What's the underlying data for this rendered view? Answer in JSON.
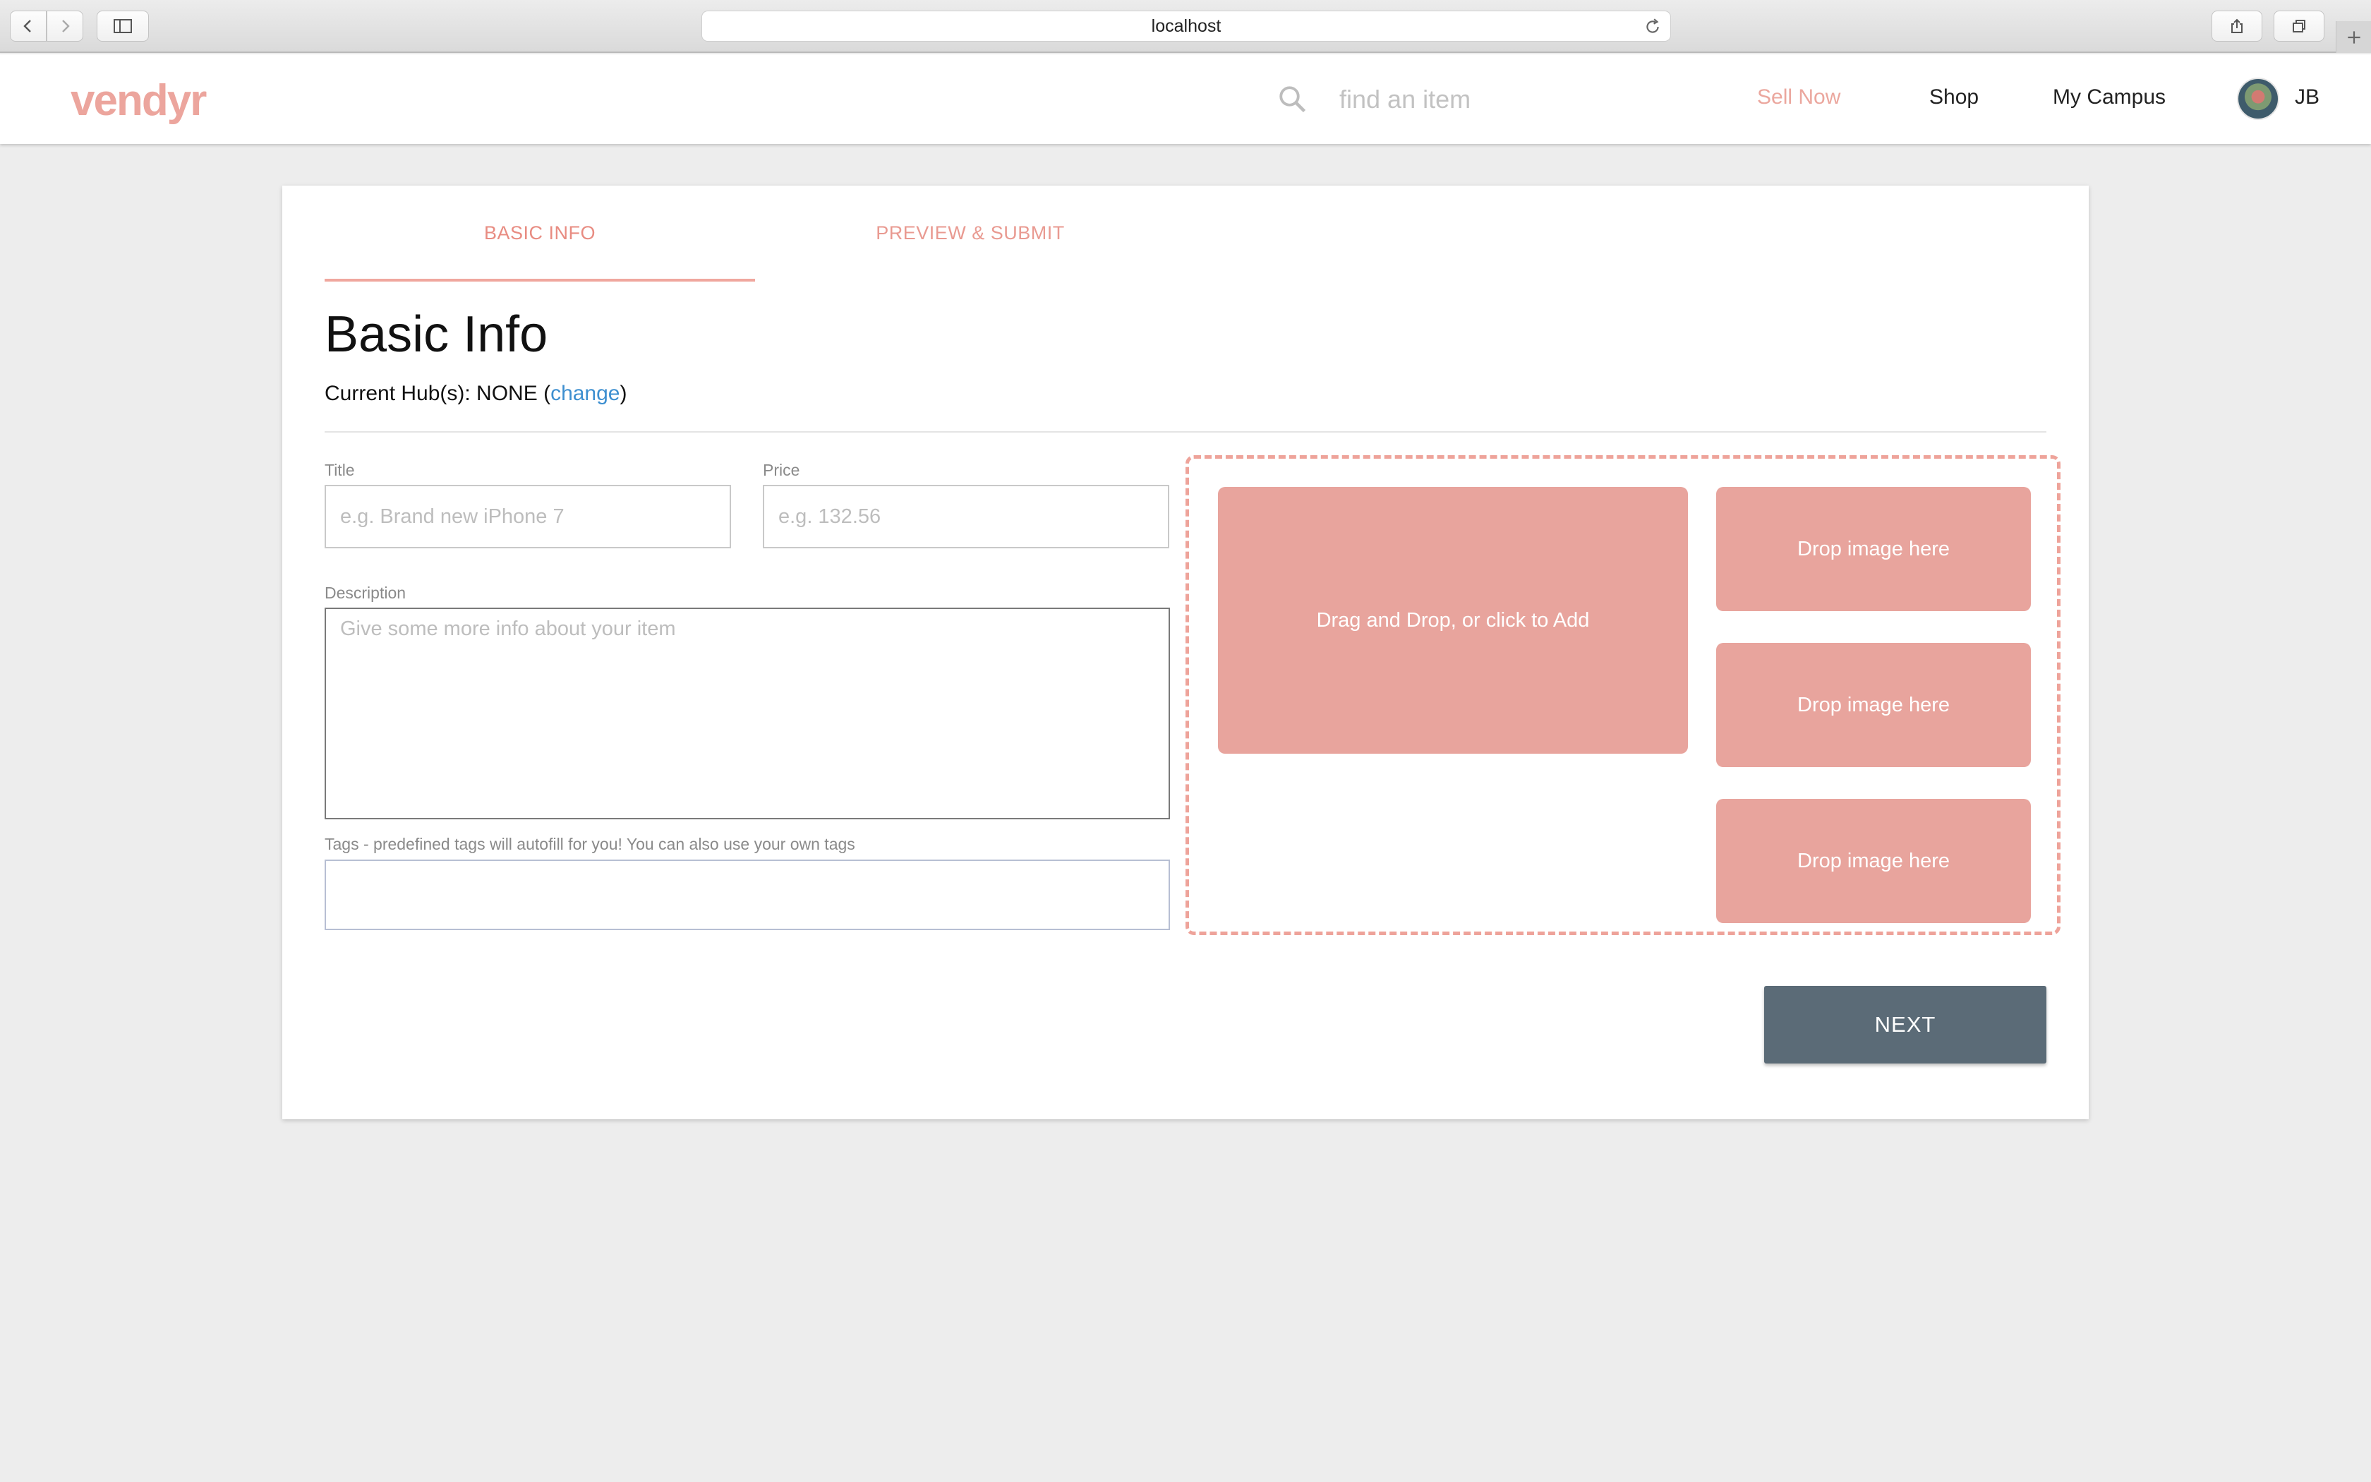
{
  "browser": {
    "url": "localhost"
  },
  "header": {
    "logo": "vendyr",
    "search_placeholder": "find an item",
    "nav": {
      "sell": "Sell Now",
      "shop": "Shop",
      "campus": "My Campus"
    },
    "user_initials": "JB"
  },
  "tabs": {
    "basic": "BASIC INFO",
    "preview": "PREVIEW & SUBMIT",
    "active": "BASIC INFO"
  },
  "form": {
    "heading": "Basic Info",
    "hub_prefix": "Current Hub(s): NONE (",
    "hub_change": "change",
    "hub_suffix": ")",
    "title_label": "Title",
    "title_placeholder": "e.g. Brand new iPhone 7",
    "title_value": "",
    "price_label": "Price",
    "price_placeholder": "e.g. 132.56",
    "price_value": "",
    "desc_label": "Description",
    "desc_placeholder": "Give some more info about your item",
    "desc_value": "",
    "tags_label": "Tags - predefined tags will autofill for you! You can also use your own tags",
    "tags_value": ""
  },
  "images": {
    "main": "Drag and Drop, or click to Add",
    "slots": [
      "Drop image here",
      "Drop image here",
      "Drop image here"
    ]
  },
  "actions": {
    "next": "NEXT"
  },
  "colors": {
    "brand": "#eca59d",
    "drop_tile": "#e8a49d",
    "link": "#3d8fd0",
    "next_button": "#5b6b77",
    "page_bg": "#ededed"
  }
}
